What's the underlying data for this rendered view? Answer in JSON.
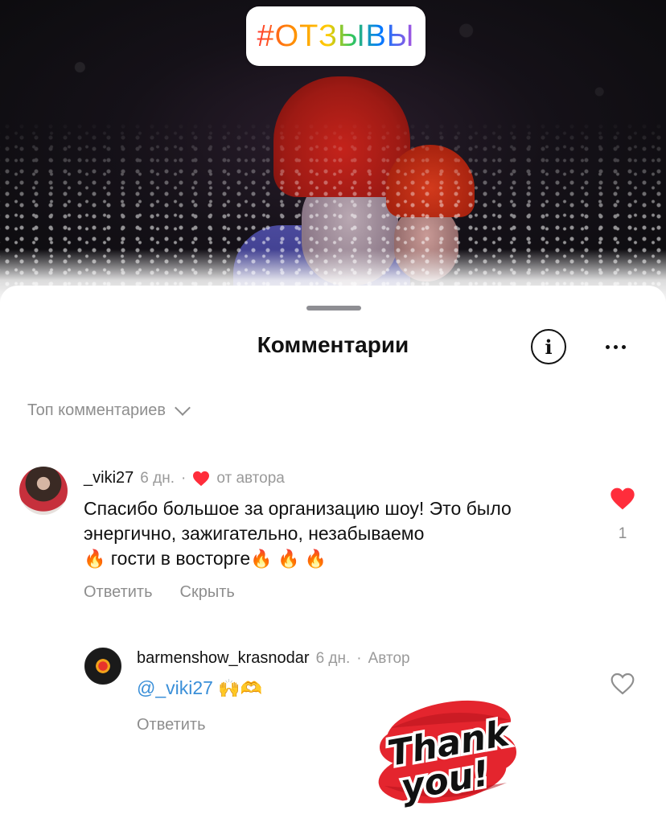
{
  "hashtag": "#ОТЗЫВЫ",
  "sheet": {
    "title": "Комментарии",
    "info_label": "i",
    "sort_label": "Топ комментариев"
  },
  "comments": [
    {
      "username": "_viki27",
      "time": "6 дн.",
      "author_like_label": "от автора",
      "text_main": "Спасибо большое за организацию шоу! Это было энергично, зажигательно, незабываемо",
      "text_tail": " гости в восторге",
      "fire_emoji": "🔥",
      "reply_label": "Ответить",
      "hide_label": "Скрыть",
      "likes": "1",
      "liked": true
    },
    {
      "username": "barmenshow_krasnodar",
      "time": "6 дн.",
      "author_badge": "Автор",
      "mention": "@_viki27",
      "emojis": "🙌🫶",
      "reply_label": "Ответить",
      "liked": false
    }
  ],
  "sticker": {
    "line1": "Thank",
    "line2": "you!"
  },
  "colors": {
    "like_red": "#ff2d3b",
    "mention_blue": "#3a8fd8",
    "muted_text": "#8e8e8e"
  },
  "icons": {
    "info": "info-circle-icon",
    "more": "ellipsis-icon",
    "sort": "chevron-down-icon",
    "like_filled": "heart-filled-icon",
    "like_outline": "heart-outline-icon"
  }
}
